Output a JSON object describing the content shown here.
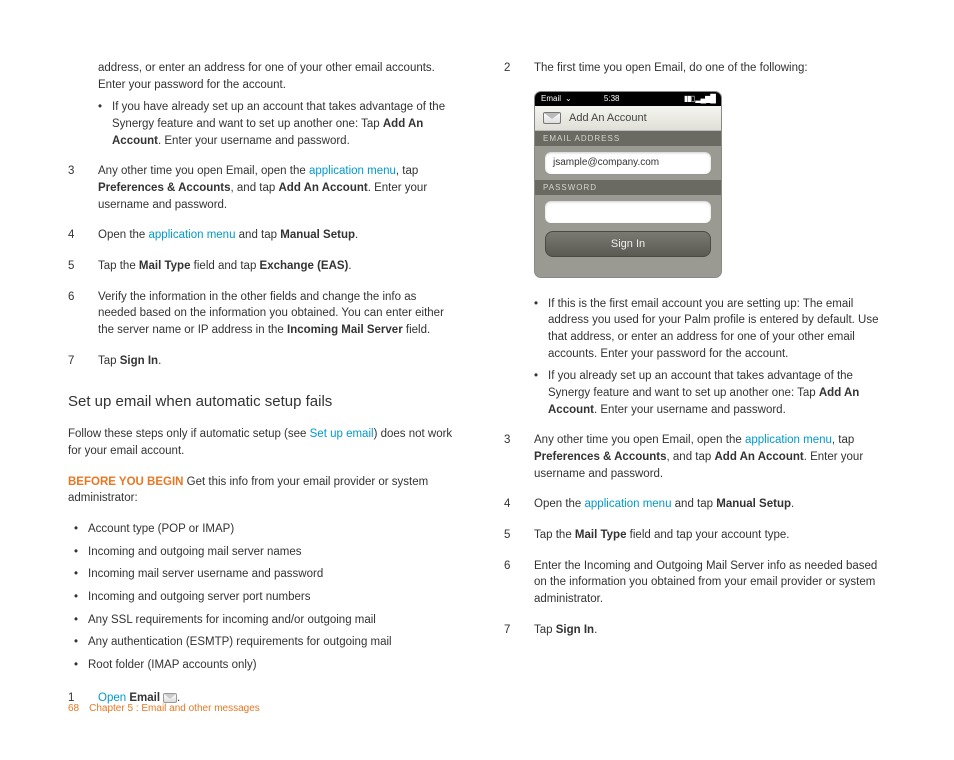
{
  "left": {
    "cont1": "address, or enter an address for one of your other email accounts. Enter your password for the account.",
    "cont2_a": "If you have already set up an account that takes advantage of the Synergy feature and want to set up another one: Tap ",
    "cont2_b": "Add An Account",
    "cont2_c": ". Enter your username and password.",
    "s3_a": "Any other time you open Email, open the ",
    "s3_link": "application menu",
    "s3_b": ", tap ",
    "s3_bold1": "Preferences & Accounts",
    "s3_c": ", and tap ",
    "s3_bold2": "Add An Account",
    "s3_d": ". Enter your username and password.",
    "s4_a": "Open the ",
    "s4_link": "application menu",
    "s4_b": " and tap ",
    "s4_bold": "Manual Setup",
    "s4_c": ".",
    "s5_a": "Tap the ",
    "s5_bold1": "Mail Type",
    "s5_b": " field and tap ",
    "s5_bold2": "Exchange (EAS)",
    "s5_c": ".",
    "s6_a": "Verify the information in the other fields and change the info as needed based on the information you obtained. You can enter either the server name or IP address in the ",
    "s6_bold": "Incoming Mail Server",
    "s6_b": " field.",
    "s7_a": "Tap ",
    "s7_bold": "Sign In",
    "s7_b": ".",
    "h2": "Set up email when automatic setup fails",
    "p1_a": "Follow these steps only if automatic setup (see ",
    "p1_link": "Set up email",
    "p1_b": ") does not work for your email account.",
    "byb": "BEFORE YOU BEGIN",
    "byb_t": "  Get this info from your email provider or system administrator:",
    "bl": [
      "Account type (POP or IMAP)",
      "Incoming and outgoing mail server names",
      "Incoming mail server username and password",
      "Incoming and outgoing server port numbers",
      "Any SSL requirements for incoming and/or outgoing mail",
      "Any authentication (ESMTP) requirements for outgoing mail",
      "Root folder (IMAP accounts only)"
    ],
    "s1_link": "Open",
    "s1_bold": "Email",
    "s1_dot": "."
  },
  "right": {
    "s2": "The first time you open Email, do one of the following:",
    "phone": {
      "status_app": "Email",
      "time": "5:38",
      "header": "Add An Account",
      "label_email": "EMAIL ADDRESS",
      "value_email": "jsample@company.com",
      "label_pw": "PASSWORD",
      "signin": "Sign In"
    },
    "rb1": "If this is the first email account you are setting up: The email address you used for your Palm profile is entered by default. Use that address, or enter an address for one of your other email accounts. Enter your password for the account.",
    "rb2_a": "If you already set up an account that takes advantage of the Synergy feature and want to set up another one: Tap ",
    "rb2_bold": "Add An Account",
    "rb2_b": ". Enter your username and password.",
    "s3_a": "Any other time you open Email, open the ",
    "s3_link": "application menu",
    "s3_b": ", tap ",
    "s3_bold1": "Preferences & Accounts",
    "s3_c": ", and tap ",
    "s3_bold2": "Add An Account",
    "s3_d": ". Enter your username and password.",
    "s4_a": "Open the ",
    "s4_link": "application menu",
    "s4_b": " and tap ",
    "s4_bold": "Manual Setup",
    "s4_c": ".",
    "s5_a": "Tap the ",
    "s5_bold": "Mail Type",
    "s5_b": " field and tap your account type.",
    "s6": "Enter the Incoming and Outgoing Mail Server info as needed based on the information you obtained from your email provider or system administrator.",
    "s7_a": "Tap ",
    "s7_bold": "Sign In",
    "s7_b": "."
  },
  "footer": {
    "page": "68",
    "chapter": "Chapter 5 : Email and other messages"
  }
}
